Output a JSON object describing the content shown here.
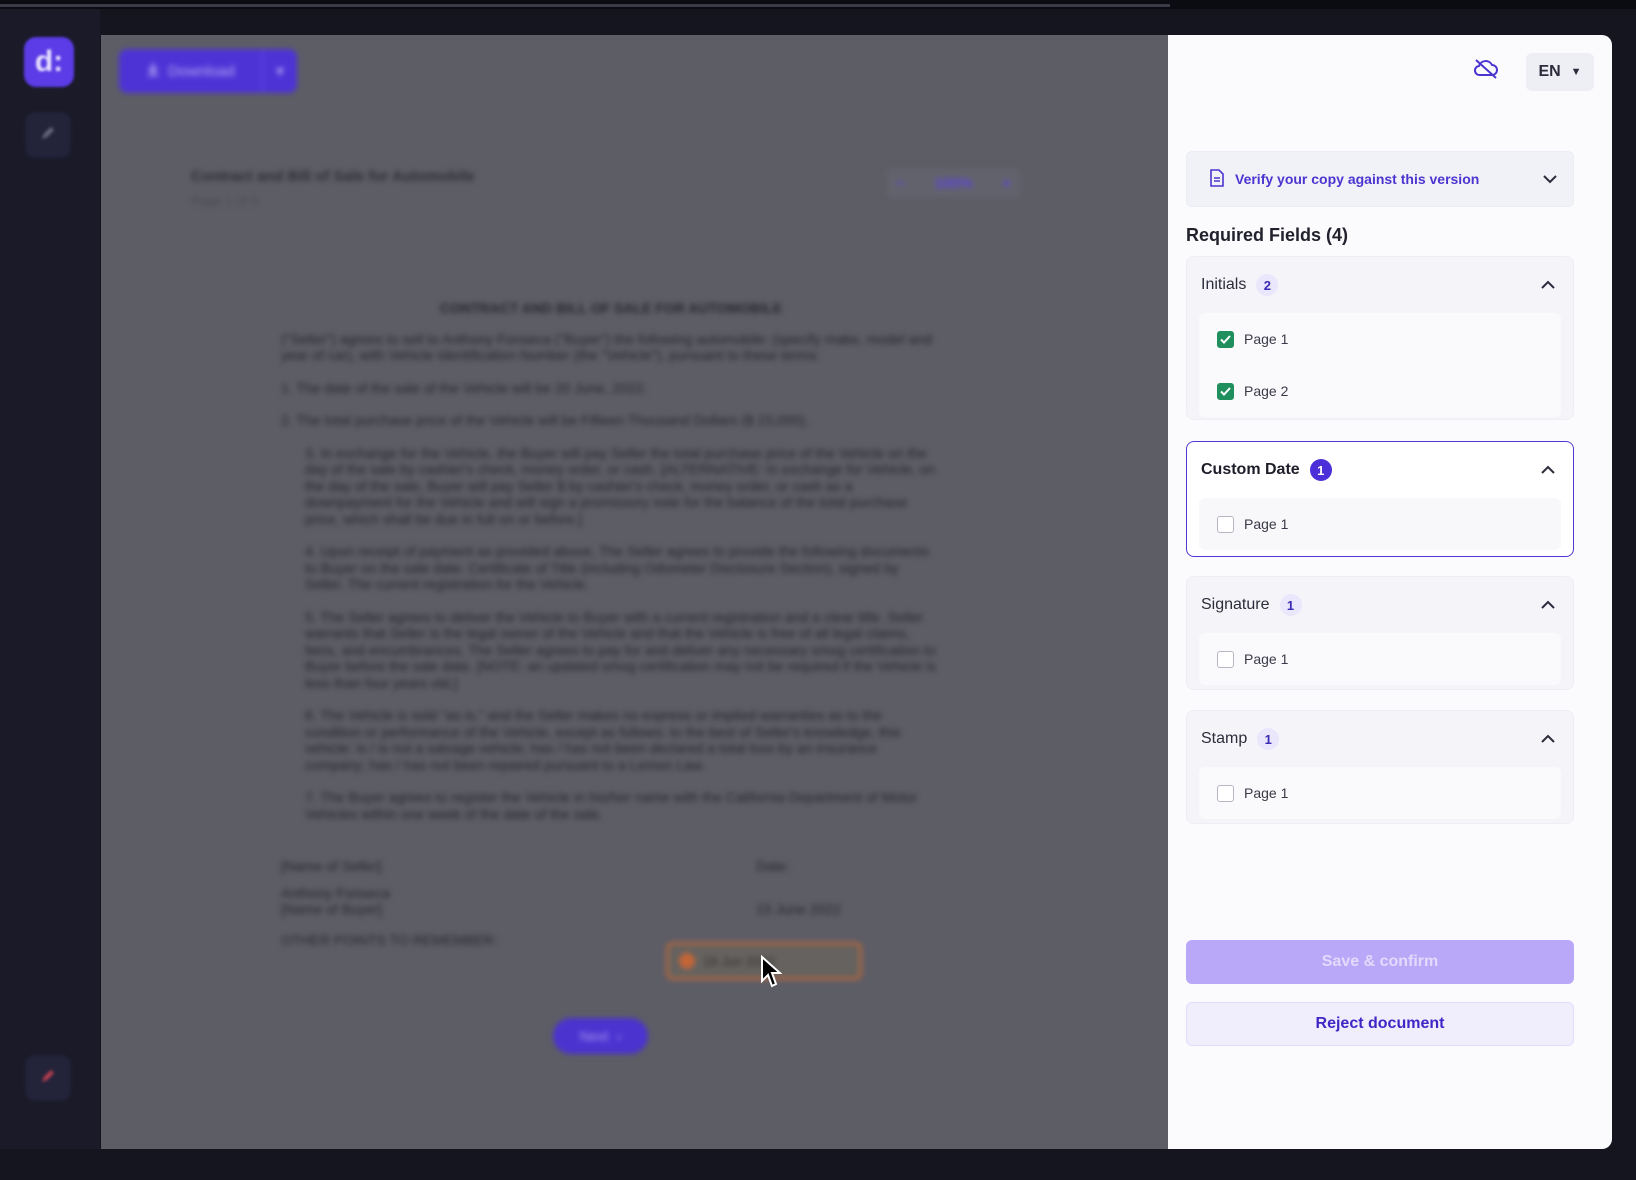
{
  "app": {
    "logo_text": "d"
  },
  "toolbar": {
    "download_label": "Download"
  },
  "document": {
    "title": "Contract and Bill of Sale for Automobile",
    "page_info": "Page 1 of 4",
    "zoom_minus": "−",
    "zoom_level": "100%",
    "zoom_plus": "+",
    "heading": "CONTRACT AND BILL OF SALE FOR AUTOMOBILE",
    "paragraphs": [
      "(\"Seller\") agrees to sell to Anthony Fonseca (\"Buyer\") the following automobile: (specify make, model and year of car), with Vehicle Identification Number (the \"Vehicle\"), pursuant to these terms:",
      "1. The date of the sale of the Vehicle will be 20 June, 2022.",
      "2. The total purchase price of the Vehicle will be Fifteen Thousand Dollars ($ 15,000).",
      "3. In exchange for the Vehicle, the Buyer will pay Seller the total purchase price of the Vehicle on the day of the sale by cashier's check, money order, or cash. [ALTERNATIVE: In exchange for Vehicle, on the day of the sale, Buyer will pay Seller $ by cashier's check, money order, or cash as a downpayment for the Vehicle and will sign a promissory note for the balance of the total purchase price, which shall be due in full on or before.]",
      "4. Upon receipt of payment as provided above, The Seller agrees to provide the following documents to Buyer on the sale date: Certificate of Title (including Odometer Disclosure Section), signed by Seller. The current registration for the Vehicle.",
      "5. The Seller agrees to deliver the Vehicle to Buyer with a current registration and a clear title. Seller warrants that Seller is the legal owner of the Vehicle and that the Vehicle is free of all legal claims, liens, and encumbrances. The Seller agrees to pay for and deliver any necessary smog certification to Buyer before the sale date. [NOTE: an updated smog certification may not be required if the Vehicle is less than four years old.]",
      "6. The Vehicle is sold \"as is,\" and the Seller makes no express or implied warranties as to the condition or performance of the Vehicle, except as follows: to the best of Seller's knowledge, this vehicle: is / is not a salvage vehicle; has / has not been declared a total loss by an insurance company; has / has not been repaired pursuant to a Lemon Law.",
      "7. The Buyer agrees to register the Vehicle in his/her name with the California Department of Motor Vehicles within one week of the date of the sale."
    ],
    "seller_label": "[Name of Seller]",
    "buyer_name": "Anthony Fonseca",
    "buyer_label": "[Name of Buyer]",
    "date_label": "Date:",
    "date_field_value": "19 Jun 2022",
    "buyer_date": "15 June 2022",
    "footer": "OTHER POINTS TO REMEMBER:",
    "next_label": "Next"
  },
  "panel": {
    "language": "EN",
    "verify_label": "Verify your copy against this version",
    "required_title": "Required Fields (4)",
    "groups": [
      {
        "label": "Initials",
        "count": "2",
        "items": [
          {
            "label": "Page 1",
            "checked": true
          },
          {
            "label": "Page 2",
            "checked": true
          }
        ]
      },
      {
        "label": "Custom Date",
        "count": "1",
        "items": [
          {
            "label": "Page 1",
            "checked": false
          }
        ]
      },
      {
        "label": "Signature",
        "count": "1",
        "items": [
          {
            "label": "Page 1",
            "checked": false
          }
        ]
      },
      {
        "label": "Stamp",
        "count": "1",
        "items": [
          {
            "label": "Page 1",
            "checked": false
          }
        ]
      }
    ],
    "save_label": "Save & confirm",
    "reject_label": "Reject document"
  },
  "colors": {
    "accent": "#4c2fd8",
    "checked": "#1f8f5e",
    "rail_bg": "#1a1a28"
  },
  "icons": [
    "cloud-off-icon",
    "document-icon",
    "chevron-down-icon",
    "chevron-up-icon",
    "pen-icon",
    "download-icon",
    "cursor-icon"
  ]
}
